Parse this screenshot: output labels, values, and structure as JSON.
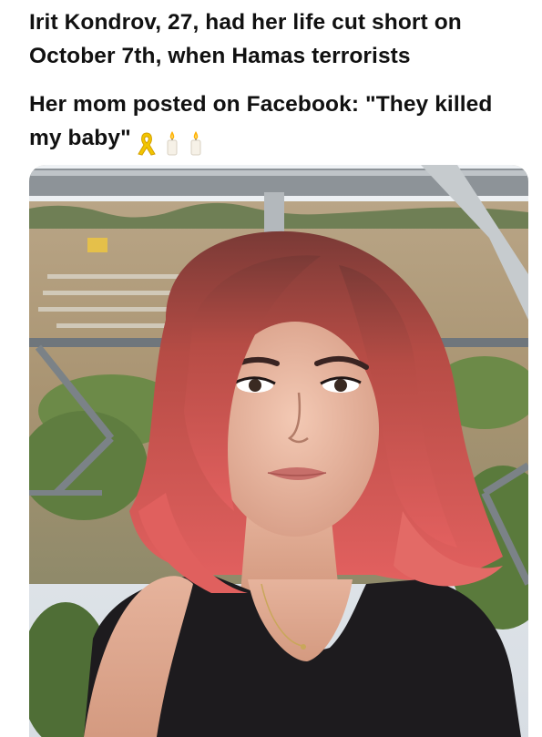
{
  "post": {
    "headline": "Irit Kondrov, 27, had her life cut short on October 7th, when Hamas terrorists",
    "quote_text": "Her mom posted on Facebook: \"They killed my baby\"",
    "emojis": [
      "yellow-ribbon-icon",
      "candle-icon",
      "candle-icon"
    ]
  },
  "photo": {
    "subject": "selfie photo",
    "colors": {
      "sky": "#dfe6ee",
      "ground": "#b59f7e",
      "trees": "#6f8a4e",
      "hair": "#c94a4c",
      "skin": "#e9b69f",
      "shirt": "#1c1a1d",
      "railing": "#8c9196"
    }
  }
}
